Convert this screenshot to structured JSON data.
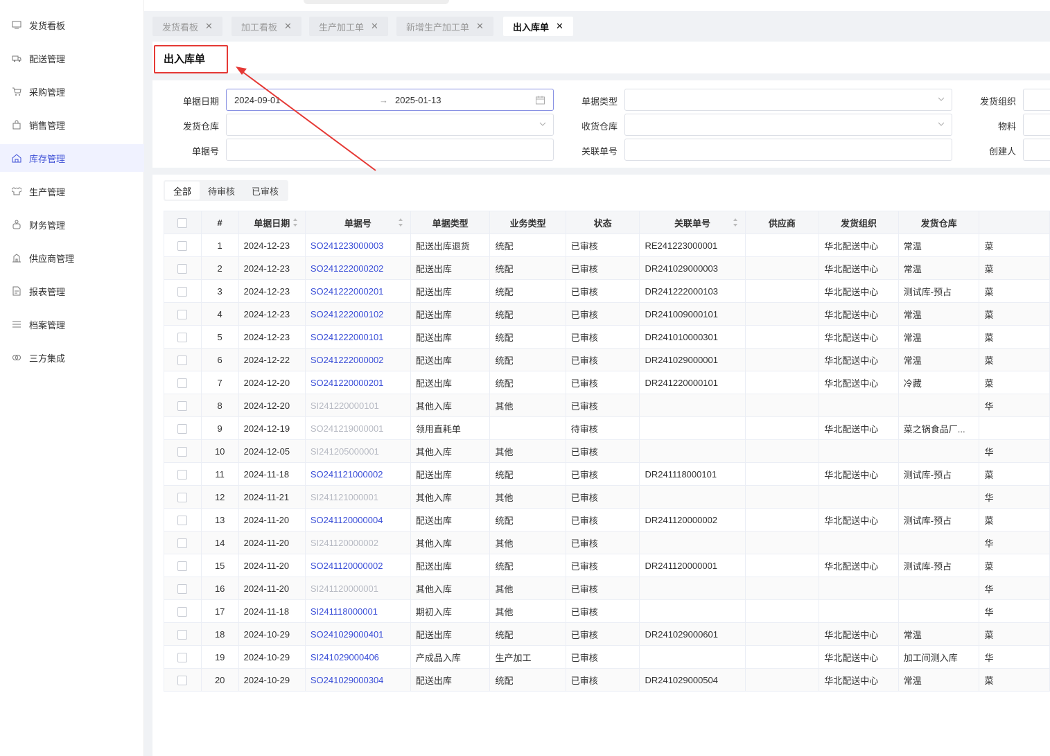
{
  "sidebar": {
    "items": [
      {
        "label": "发货看板",
        "icon": "monitor-icon"
      },
      {
        "label": "配送管理",
        "icon": "truck-icon"
      },
      {
        "label": "采购管理",
        "icon": "cart-icon"
      },
      {
        "label": "销售管理",
        "icon": "bag-icon"
      },
      {
        "label": "库存管理",
        "icon": "home-icon",
        "active": true
      },
      {
        "label": "生产管理",
        "icon": "chef-icon"
      },
      {
        "label": "财务管理",
        "icon": "wallet-icon"
      },
      {
        "label": "供应商管理",
        "icon": "building-icon"
      },
      {
        "label": "报表管理",
        "icon": "report-icon"
      },
      {
        "label": "档案管理",
        "icon": "list-icon"
      },
      {
        "label": "三方集成",
        "icon": "link-icon"
      }
    ]
  },
  "tabs": [
    {
      "label": "发货看板"
    },
    {
      "label": "加工看板"
    },
    {
      "label": "生产加工单"
    },
    {
      "label": "新增生产加工单"
    },
    {
      "label": "出入库单",
      "active": true
    }
  ],
  "page": {
    "title": "出入库单"
  },
  "filters": {
    "doc_date_label": "单据日期",
    "doc_date_start": "2024-09-01",
    "doc_date_sep": "→",
    "doc_date_end": "2025-01-13",
    "doc_type_label": "单据类型",
    "ship_org_label": "发货组织",
    "ship_wh_label": "发货仓库",
    "recv_wh_label": "收货仓库",
    "material_label": "物料",
    "doc_no_label": "单据号",
    "ref_no_label": "关联单号",
    "creator_label": "创建人"
  },
  "segments": [
    "全部",
    "待审核",
    "已审核"
  ],
  "table": {
    "columns": [
      "#",
      "单据日期",
      "单据号",
      "单据类型",
      "业务类型",
      "状态",
      "关联单号",
      "供应商",
      "发货组织",
      "发货仓库"
    ],
    "rows": [
      {
        "n": "1",
        "date": "2024-12-23",
        "no": "SO241223000003",
        "type": "配送出库退货",
        "biz": "统配",
        "status": "已审核",
        "ref": "RE241223000001",
        "sup": "",
        "org": "华北配送中心",
        "wh": "常温",
        "extra": "菜",
        "dim": false
      },
      {
        "n": "2",
        "date": "2024-12-23",
        "no": "SO241222000202",
        "type": "配送出库",
        "biz": "统配",
        "status": "已审核",
        "ref": "DR241029000003",
        "sup": "",
        "org": "华北配送中心",
        "wh": "常温",
        "extra": "菜",
        "dim": false
      },
      {
        "n": "3",
        "date": "2024-12-23",
        "no": "SO241222000201",
        "type": "配送出库",
        "biz": "统配",
        "status": "已审核",
        "ref": "DR241222000103",
        "sup": "",
        "org": "华北配送中心",
        "wh": "测试库-预占",
        "extra": "菜",
        "dim": false
      },
      {
        "n": "4",
        "date": "2024-12-23",
        "no": "SO241222000102",
        "type": "配送出库",
        "biz": "统配",
        "status": "已审核",
        "ref": "DR241009000101",
        "sup": "",
        "org": "华北配送中心",
        "wh": "常温",
        "extra": "菜",
        "dim": false
      },
      {
        "n": "5",
        "date": "2024-12-23",
        "no": "SO241222000101",
        "type": "配送出库",
        "biz": "统配",
        "status": "已审核",
        "ref": "DR241010000301",
        "sup": "",
        "org": "华北配送中心",
        "wh": "常温",
        "extra": "菜",
        "dim": false
      },
      {
        "n": "6",
        "date": "2024-12-22",
        "no": "SO241222000002",
        "type": "配送出库",
        "biz": "统配",
        "status": "已审核",
        "ref": "DR241029000001",
        "sup": "",
        "org": "华北配送中心",
        "wh": "常温",
        "extra": "菜",
        "dim": false
      },
      {
        "n": "7",
        "date": "2024-12-20",
        "no": "SO241220000201",
        "type": "配送出库",
        "biz": "统配",
        "status": "已审核",
        "ref": "DR241220000101",
        "sup": "",
        "org": "华北配送中心",
        "wh": "冷藏",
        "extra": "菜",
        "dim": false
      },
      {
        "n": "8",
        "date": "2024-12-20",
        "no": "SI241220000101",
        "type": "其他入库",
        "biz": "其他",
        "status": "已审核",
        "ref": "",
        "sup": "",
        "org": "",
        "wh": "",
        "extra": "华",
        "dim": true
      },
      {
        "n": "9",
        "date": "2024-12-19",
        "no": "SO241219000001",
        "type": "领用直耗单",
        "biz": "",
        "status": "待审核",
        "ref": "",
        "sup": "",
        "org": "华北配送中心",
        "wh": "菜之锅食品厂...",
        "extra": "",
        "dim": true
      },
      {
        "n": "10",
        "date": "2024-12-05",
        "no": "SI241205000001",
        "type": "其他入库",
        "biz": "其他",
        "status": "已审核",
        "ref": "",
        "sup": "",
        "org": "",
        "wh": "",
        "extra": "华",
        "dim": true
      },
      {
        "n": "11",
        "date": "2024-11-18",
        "no": "SO241121000002",
        "type": "配送出库",
        "biz": "统配",
        "status": "已审核",
        "ref": "DR241118000101",
        "sup": "",
        "org": "华北配送中心",
        "wh": "测试库-预占",
        "extra": "菜",
        "dim": false
      },
      {
        "n": "12",
        "date": "2024-11-21",
        "no": "SI241121000001",
        "type": "其他入库",
        "biz": "其他",
        "status": "已审核",
        "ref": "",
        "sup": "",
        "org": "",
        "wh": "",
        "extra": "华",
        "dim": true
      },
      {
        "n": "13",
        "date": "2024-11-20",
        "no": "SO241120000004",
        "type": "配送出库",
        "biz": "统配",
        "status": "已审核",
        "ref": "DR241120000002",
        "sup": "",
        "org": "华北配送中心",
        "wh": "测试库-预占",
        "extra": "菜",
        "dim": false
      },
      {
        "n": "14",
        "date": "2024-11-20",
        "no": "SI241120000002",
        "type": "其他入库",
        "biz": "其他",
        "status": "已审核",
        "ref": "",
        "sup": "",
        "org": "",
        "wh": "",
        "extra": "华",
        "dim": true
      },
      {
        "n": "15",
        "date": "2024-11-20",
        "no": "SO241120000002",
        "type": "配送出库",
        "biz": "统配",
        "status": "已审核",
        "ref": "DR241120000001",
        "sup": "",
        "org": "华北配送中心",
        "wh": "测试库-预占",
        "extra": "菜",
        "dim": false
      },
      {
        "n": "16",
        "date": "2024-11-20",
        "no": "SI241120000001",
        "type": "其他入库",
        "biz": "其他",
        "status": "已审核",
        "ref": "",
        "sup": "",
        "org": "",
        "wh": "",
        "extra": "华",
        "dim": true
      },
      {
        "n": "17",
        "date": "2024-11-18",
        "no": "SI241118000001",
        "type": "期初入库",
        "biz": "其他",
        "status": "已审核",
        "ref": "",
        "sup": "",
        "org": "",
        "wh": "",
        "extra": "华",
        "dim": false
      },
      {
        "n": "18",
        "date": "2024-10-29",
        "no": "SO241029000401",
        "type": "配送出库",
        "biz": "统配",
        "status": "已审核",
        "ref": "DR241029000601",
        "sup": "",
        "org": "华北配送中心",
        "wh": "常温",
        "extra": "菜",
        "dim": false
      },
      {
        "n": "19",
        "date": "2024-10-29",
        "no": "SI241029000406",
        "type": "产成品入库",
        "biz": "生产加工",
        "status": "已审核",
        "ref": "",
        "sup": "",
        "org": "华北配送中心",
        "wh": "加工间测入库",
        "extra": "华",
        "dim": false
      },
      {
        "n": "20",
        "date": "2024-10-29",
        "no": "SO241029000304",
        "type": "配送出库",
        "biz": "统配",
        "status": "已审核",
        "ref": "DR241029000504",
        "sup": "",
        "org": "华北配送中心",
        "wh": "常温",
        "extra": "菜",
        "dim": false
      }
    ]
  },
  "colors": {
    "accent": "#3d4fd6",
    "annotation": "#e53935"
  }
}
